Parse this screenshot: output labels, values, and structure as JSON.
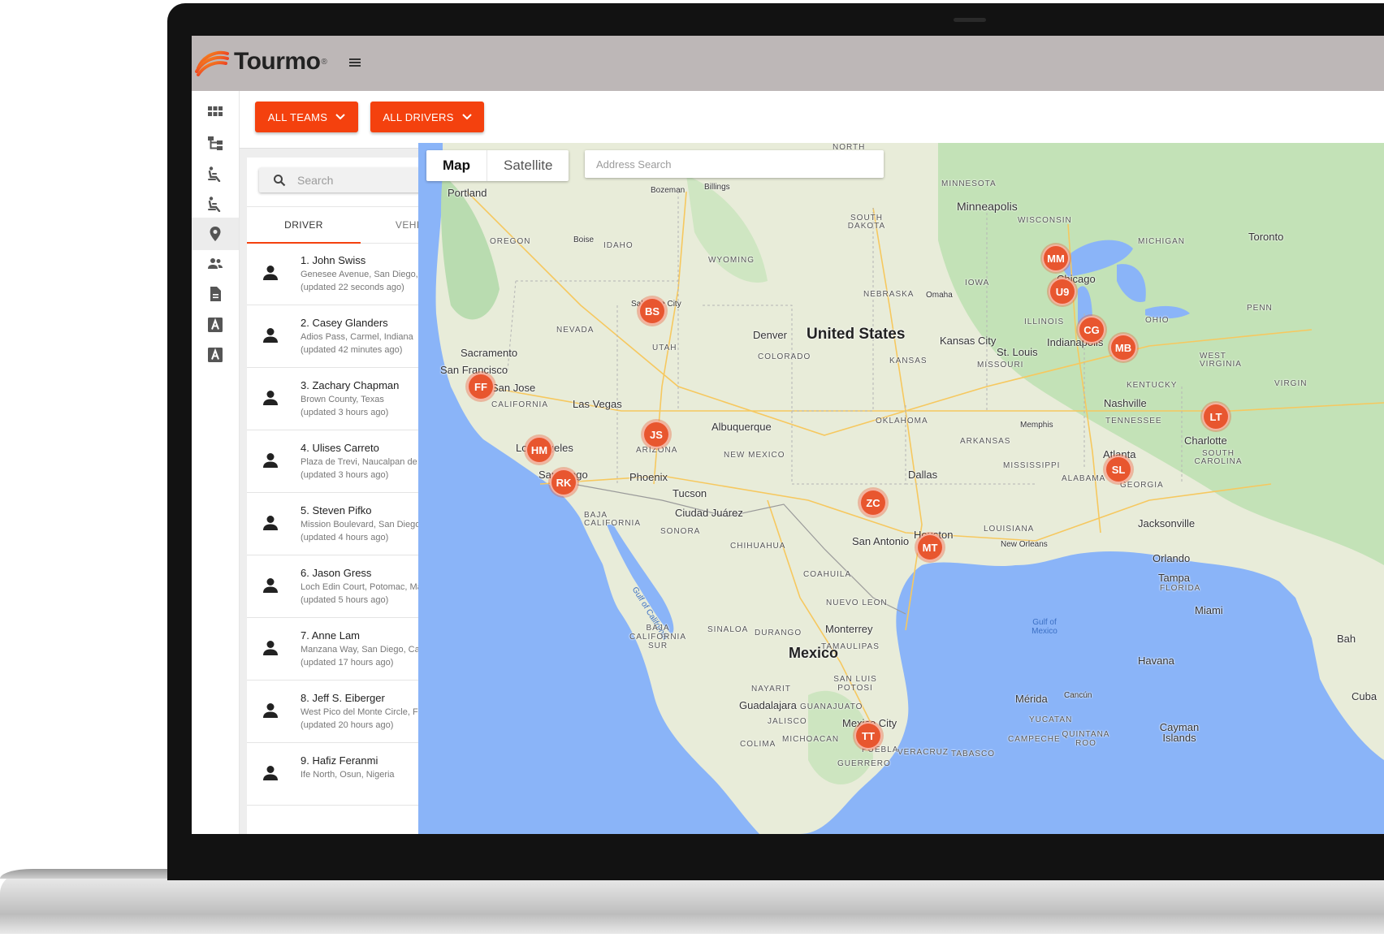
{
  "app": {
    "brand": "Tourmo",
    "brand_mark": "®"
  },
  "filters": {
    "teams_label": "ALL TEAMS",
    "drivers_label": "ALL DRIVERS"
  },
  "nav": {
    "items": [
      {
        "icon": "dashboard-icon"
      },
      {
        "icon": "hierarchy-icon"
      },
      {
        "icon": "seat-icon"
      },
      {
        "icon": "seat-alt-icon"
      },
      {
        "icon": "map-pin-icon",
        "active": true
      },
      {
        "icon": "people-icon"
      },
      {
        "icon": "document-icon"
      },
      {
        "icon": "letter-a-icon"
      },
      {
        "icon": "letter-a-alt-icon"
      }
    ]
  },
  "panel": {
    "search_placeholder": "Search",
    "tabs": [
      {
        "label": "DRIVER",
        "active": true
      },
      {
        "label": "VEHICLE",
        "active": false
      }
    ],
    "drivers": [
      {
        "name": "1. John Swiss",
        "address": "Genesee Avenue, San Diego, Califo...",
        "updated": "(updated 22 seconds ago)"
      },
      {
        "name": "2. Casey Glanders",
        "address": "Adios Pass, Carmel, Indiana",
        "updated": "(updated 42 minutes ago)"
      },
      {
        "name": "3. Zachary Chapman",
        "address": "Brown County, Texas",
        "updated": "(updated 3 hours ago)"
      },
      {
        "name": "4. Ulises Carreto",
        "address": "Plaza de Trevi, Naucalpan de Juáre...",
        "updated": "(updated 3 hours ago)"
      },
      {
        "name": "5. Steven Pifko",
        "address": "Mission Boulevard, San Diego, Calif...",
        "updated": "(updated 4 hours ago)"
      },
      {
        "name": "6. Jason Gress",
        "address": "Loch Edin Court, Potomac, Maryland",
        "updated": "(updated 5 hours ago)"
      },
      {
        "name": "7. Anne Lam",
        "address": "Manzana Way, San Diego, California",
        "updated": "(updated 17 hours ago)"
      },
      {
        "name": "8. Jeff S. Eiberger",
        "address": "West Pico del Monte Circle, Flagst...",
        "updated": "(updated 20 hours ago)"
      },
      {
        "name": "9. Hafiz Feranmi",
        "address": "Ife North, Osun, Nigeria",
        "updated": ""
      }
    ]
  },
  "map": {
    "type_map": "Map",
    "type_satellite": "Satellite",
    "address_placeholder": "Address Search",
    "labels": {
      "portland": "Portland",
      "bozeman": "Bozeman",
      "billings": "Billings",
      "minnesota": "MINNESOTA",
      "minneapolis": "Minneapolis",
      "wisconsin": "WISCONSIN",
      "michigan": "MICHIGAN",
      "toronto": "Toronto",
      "oregon": "OREGON",
      "boise": "Boise",
      "idaho": "IDAHO",
      "wyoming": "WYOMING",
      "south_dakota": "SOUTH DAKOTA",
      "iowa": "IOWA",
      "nebraska": "NEBRASKA",
      "omaha": "Omaha",
      "chicago": "Chicago",
      "illinois": "ILLINOIS",
      "ohio": "OHIO",
      "nevada": "NEVADA",
      "utah": "UTAH",
      "denver": "Denver",
      "united_states": "United States",
      "colorado": "COLORADO",
      "kansas": "KANSAS",
      "kansas_city": "Kansas City",
      "st_louis": "St. Louis",
      "indianapolis": "Indianapolis",
      "missouri": "MISSOURI",
      "west_virginia": "WEST VIRGINIA",
      "sacramento": "Sacramento",
      "san_francisco": "San Francisco",
      "san_jose": "San Jose",
      "california": "CALIFORNIA",
      "las_vegas": "Las Vegas",
      "kentucky": "KENTUCKY",
      "nashville": "Nashville",
      "tennessee": "TENNESSEE",
      "albuquerque": "Albuquerque",
      "oklahoma": "OKLAHOMA",
      "arizona": "ARIZONA",
      "new_mexico": "NEW MEXICO",
      "los_angeles": "Los Angeles",
      "memphis": "Memphis",
      "arkansas": "ARKANSAS",
      "charlotte": "Charlotte",
      "south_carolina": "SOUTH CAROLINA",
      "phoenix": "Phoenix",
      "san_diego": "San Diego",
      "dallas": "Dallas",
      "atlanta": "Atlanta",
      "mississippi": "MISSISSIPPI",
      "alabama": "ALABAMA",
      "georgia": "GEORGIA",
      "tucson": "Tucson",
      "ciudad_juarez": "Ciudad Juárez",
      "baja_california": "BAJA CALIFORNIA",
      "sonora": "SONORA",
      "louisiana": "LOUISIANA",
      "jacksonville": "Jacksonville",
      "san_antonio": "San Antonio",
      "houston": "Houston",
      "new_orleans": "New Orleans",
      "chihuahua": "CHIHUAHUA",
      "orlando": "Orlando",
      "tampa": "Tampa",
      "florida": "FLORIDA",
      "coahuila": "COAHUILA",
      "gulf_of_california": "Gulf of California",
      "miami": "Miami",
      "nuevo_leon": "NUEVO LEON",
      "gulf_of_mexico": "Gulf of Mexico",
      "baja_california_sur": "BAJA CALIFORNIA SUR",
      "sinaloa": "SINALOA",
      "durango": "DURANGO",
      "monterrey": "Monterrey",
      "tamaulipas": "TAMAULIPAS",
      "mexico": "Mexico",
      "havana": "Havana",
      "san_luis_potosi": "SAN LUIS POTOSI",
      "nayarit": "NAYARIT",
      "merida": "Mérida",
      "cancun": "Cancún",
      "cuba": "Cuba",
      "guadalajara": "Guadalajara",
      "guanajuato": "GUANAJUATO",
      "yucatan": "YUCATAN",
      "jalisco": "JALISCO",
      "mexico_city": "Mexico City",
      "campeche": "CAMPECHE",
      "quintana_roo": "QUINTANA ROO",
      "cayman_islands": "Cayman Islands",
      "colima": "COLIMA",
      "michoacan": "MICHOACAN",
      "puebla": "PUEBLA",
      "veracruz": "VERACRUZ",
      "tabasco": "TABASCO",
      "guerrero": "GUERRERO",
      "north": "NORTH",
      "penn": "PENN",
      "virgin": "VIRGIN",
      "bah": "Bah",
      "salt_lake_city": "Salt Lake City"
    },
    "markers": [
      "MM",
      "U9",
      "BS",
      "CG",
      "MB",
      "FF",
      "JS",
      "HM",
      "RK",
      "LT",
      "SL",
      "ZC",
      "MT",
      "TT"
    ]
  },
  "colors": {
    "accent": "#f4410e",
    "marker": "#e8562f",
    "header": "#bdb7b7"
  }
}
